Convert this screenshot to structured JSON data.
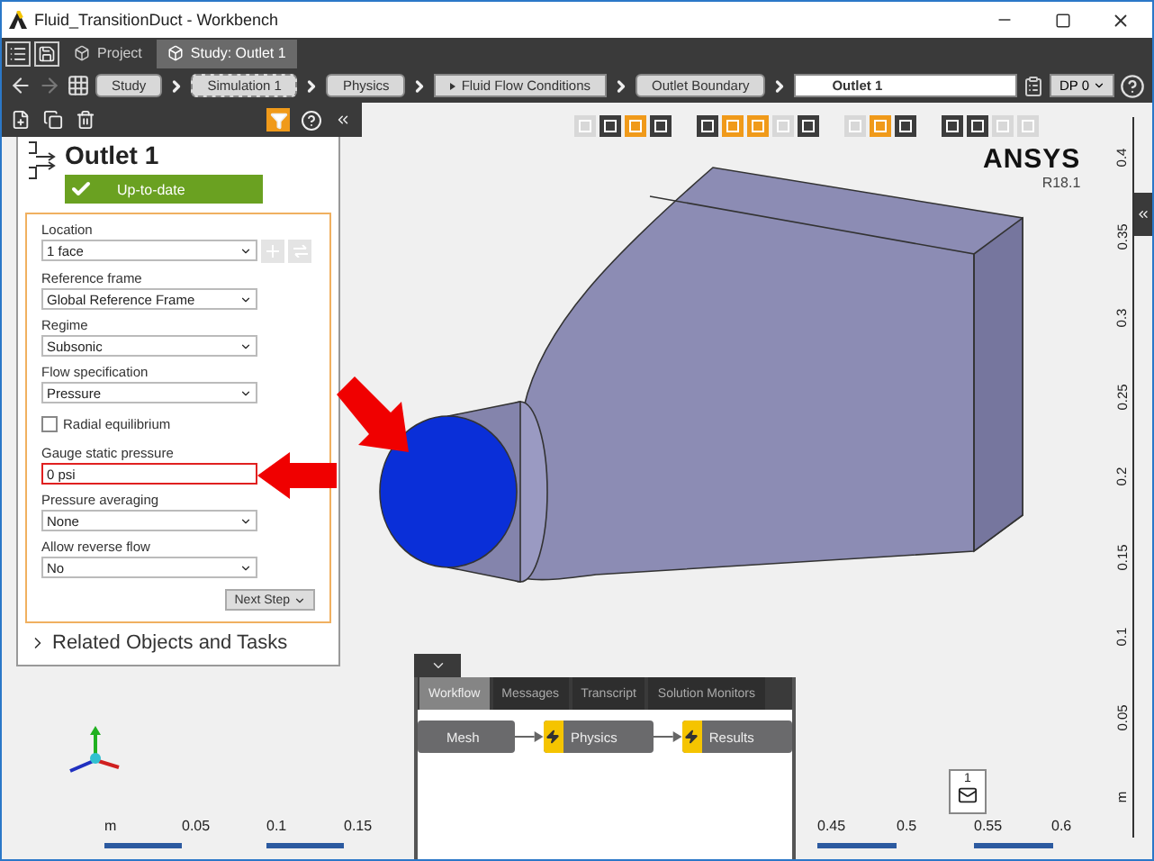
{
  "window": {
    "title": "Fluid_TransitionDuct - Workbench"
  },
  "tabs": [
    {
      "label": "Project",
      "selected": false
    },
    {
      "label": "Study: Outlet 1",
      "selected": true
    }
  ],
  "breadcrumb": [
    {
      "label": "Study",
      "kind": "step"
    },
    {
      "label": "Simulation 1",
      "kind": "dashed"
    },
    {
      "label": "Physics",
      "kind": "step"
    },
    {
      "label": "Fluid Flow Conditions",
      "kind": "expandable"
    },
    {
      "label": "Outlet Boundary",
      "kind": "step"
    },
    {
      "label": "Outlet 1",
      "kind": "current"
    }
  ],
  "design_point": {
    "label": "DP 0"
  },
  "panel": {
    "title": "Outlet 1",
    "status": "Up-to-date",
    "fields": [
      {
        "kind": "picker",
        "label": "Location",
        "value": "1 face"
      },
      {
        "kind": "select",
        "label": "Reference frame",
        "value": "Global Reference Frame"
      },
      {
        "kind": "select",
        "label": "Regime",
        "value": "Subsonic"
      },
      {
        "kind": "select",
        "label": "Flow specification",
        "value": "Pressure"
      },
      {
        "kind": "checkbox",
        "label": "Radial equilibrium",
        "checked": false
      },
      {
        "kind": "input",
        "label": "Gauge static pressure",
        "value": "0 psi",
        "highlighted": true
      },
      {
        "kind": "select",
        "label": "Pressure averaging",
        "value": "None"
      },
      {
        "kind": "select",
        "label": "Allow reverse flow",
        "value": "No"
      }
    ],
    "next_button": "Next Step",
    "related": "Related Objects and Tasks"
  },
  "viewport": {
    "brand": "ANSYS",
    "version": "R18.1",
    "toolbar": [
      [
        {
          "selected": false,
          "disabled": true
        },
        {
          "selected": false,
          "disabled": false
        },
        {
          "selected": true,
          "disabled": false
        },
        {
          "selected": false,
          "disabled": false
        }
      ],
      [
        {
          "selected": false,
          "disabled": false
        },
        {
          "selected": true,
          "disabled": false
        },
        {
          "selected": true,
          "disabled": false
        },
        {
          "selected": false,
          "disabled": true
        },
        {
          "selected": false,
          "disabled": false
        }
      ],
      [
        {
          "selected": false,
          "disabled": true
        },
        {
          "selected": true,
          "disabled": false
        },
        {
          "selected": false,
          "disabled": false
        }
      ],
      [
        {
          "selected": false,
          "disabled": false
        },
        {
          "selected": false,
          "disabled": false
        },
        {
          "selected": false,
          "disabled": true
        },
        {
          "selected": false,
          "disabled": true
        }
      ]
    ],
    "y_scale": [
      "0.4",
      "0.35",
      "0.3",
      "0.25",
      "0.2",
      "0.15",
      "0.1",
      "0.05",
      "m"
    ],
    "x_scale": [
      {
        "label": "m"
      },
      {
        "label": "0.05"
      },
      {
        "label": "0.1"
      },
      {
        "label": "0.15"
      },
      {
        "label": "0.45"
      },
      {
        "label": "0.5"
      },
      {
        "label": "0.55"
      },
      {
        "label": "0.6"
      }
    ],
    "notifications": "1"
  },
  "workflow": {
    "tabs": [
      {
        "label": "Workflow",
        "selected": true
      },
      {
        "label": "Messages",
        "selected": false
      },
      {
        "label": "Transcript",
        "selected": false
      },
      {
        "label": "Solution Monitors",
        "selected": false
      }
    ],
    "steps": [
      {
        "label": "Mesh",
        "kind": "done"
      },
      {
        "label": "Physics",
        "kind": "pending"
      },
      {
        "label": "Results",
        "kind": "pending"
      }
    ]
  }
}
